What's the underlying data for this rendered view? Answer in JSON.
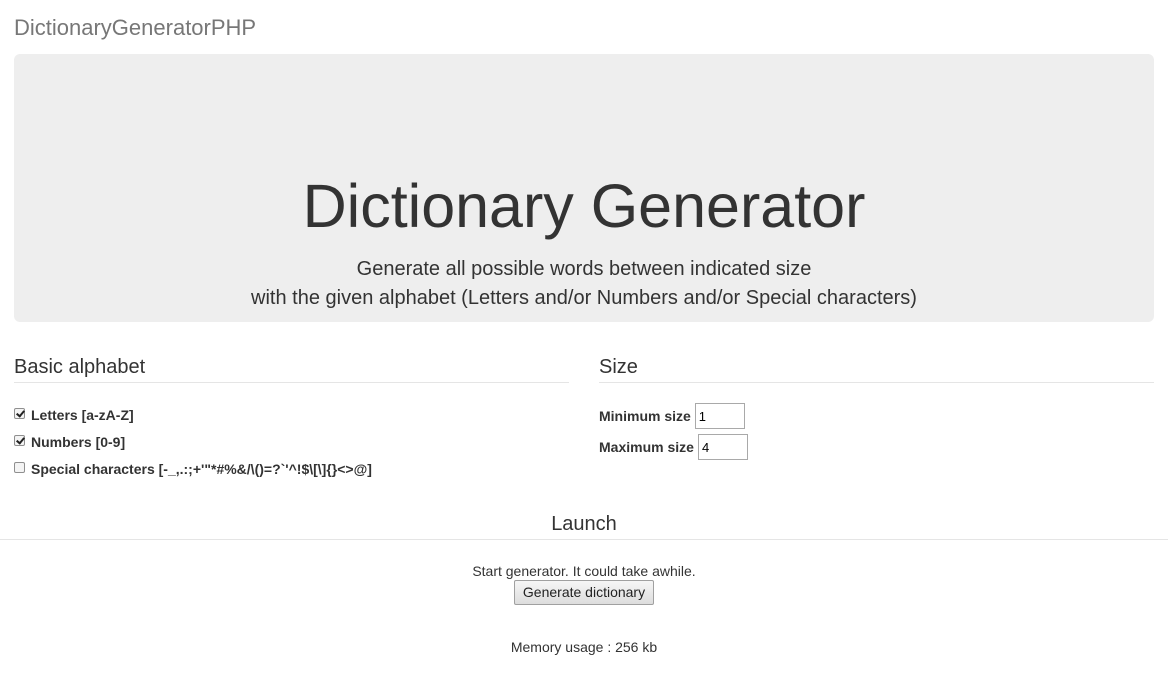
{
  "navbar": {
    "brand": "DictionaryGeneratorPHP"
  },
  "hero": {
    "title": "Dictionary Generator",
    "subtitle_line1": "Generate all possible words between indicated size",
    "subtitle_line2": "with the given alphabet (Letters and/or Numbers and/or Special characters)"
  },
  "alphabet": {
    "heading": "Basic alphabet",
    "options": [
      {
        "label": "Letters [a-zA-Z]",
        "checked": true
      },
      {
        "label": "Numbers [0-9]",
        "checked": true
      },
      {
        "label": "Special characters [-_,.:;+'\"*#%&/\\()=?`'^!$\\[\\]{}<>@]",
        "checked": false
      }
    ]
  },
  "size": {
    "heading": "Size",
    "min_label": "Minimum size",
    "min_value": "1",
    "max_label": "Maximum size",
    "max_value": "4"
  },
  "launch": {
    "heading": "Launch",
    "text": "Start generator. It could take awhile.",
    "button_label": "Generate dictionary",
    "memory": "Memory usage : 256 kb"
  }
}
